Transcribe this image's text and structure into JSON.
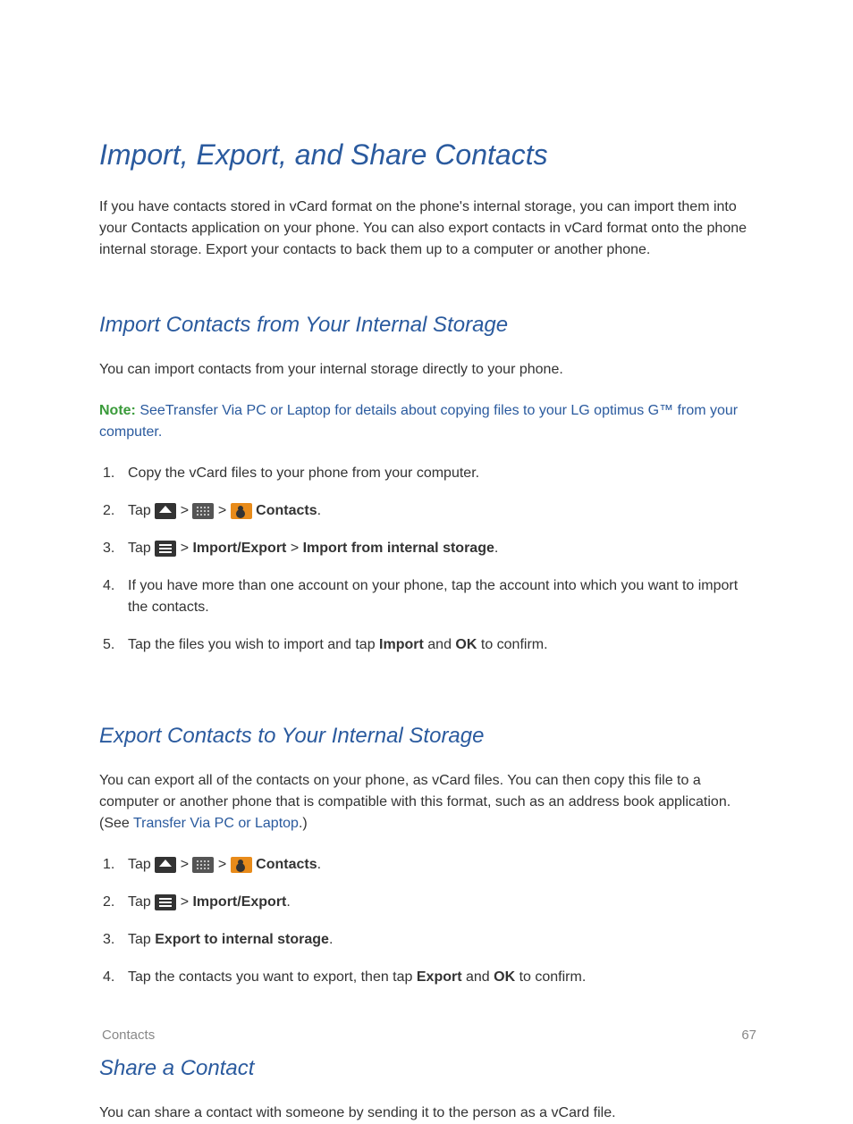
{
  "title": "Import, Export, and Share Contacts",
  "intro": "If you have contacts stored in vCard format on the phone's internal storage, you can import them into your Contacts application on your phone. You can also export contacts in vCard format onto the phone internal storage. Export your contacts to back them up to a computer or another phone.",
  "section1": {
    "heading": "Import Contacts from Your Internal Storage",
    "intro": "You can import contacts from your internal storage directly to your phone.",
    "note_label": "Note:",
    "note_see": "See",
    "note_link": "Transfer Via PC or Laptop",
    "note_rest": " for details about copying files to your LG optimus G™ from your computer.",
    "steps": {
      "s1": "Copy the vCard files to your phone from your computer.",
      "s2_tap": "Tap ",
      "s2_gt1": " > ",
      "s2_gt2": " > ",
      "s2_contacts": " Contacts",
      "s2_period": ".",
      "s3_tap": "Tap ",
      "s3_gt": " > ",
      "s3_ie": "Import/Export",
      "s3_gt2": " > ",
      "s3_from": "Import from internal storage",
      "s3_period": ".",
      "s4": "If you have more than one account on your phone, tap the account into which you want to import the contacts.",
      "s5_a": "Tap the files you wish to import and tap ",
      "s5_import": "Import",
      "s5_and": " and ",
      "s5_ok": "OK",
      "s5_end": " to confirm."
    }
  },
  "section2": {
    "heading": "Export Contacts to Your Internal Storage",
    "intro_a": "You can export all of the contacts on your phone, as vCard files. You can then copy this file to a computer or another phone that is compatible with this format, such as an address book application. (See ",
    "intro_link": "Transfer Via PC or Laptop",
    "intro_b": ".)",
    "steps": {
      "s1_tap": "Tap ",
      "s1_gt1": " > ",
      "s1_gt2": " > ",
      "s1_contacts": " Contacts",
      "s1_period": ".",
      "s2_tap": "Tap ",
      "s2_gt": " > ",
      "s2_ie": "Import/Export",
      "s2_period": ".",
      "s3_tap": "Tap ",
      "s3_export": "Export to internal storage",
      "s3_period": ".",
      "s4_a": "Tap the contacts you want to export, then tap ",
      "s4_export": "Export",
      "s4_and": " and ",
      "s4_ok": "OK",
      "s4_end": " to confirm."
    }
  },
  "section3": {
    "heading": "Share a Contact",
    "intro": "You can share a contact with someone by sending it to the person as a vCard file."
  },
  "footer": {
    "section": "Contacts",
    "page": "67"
  }
}
